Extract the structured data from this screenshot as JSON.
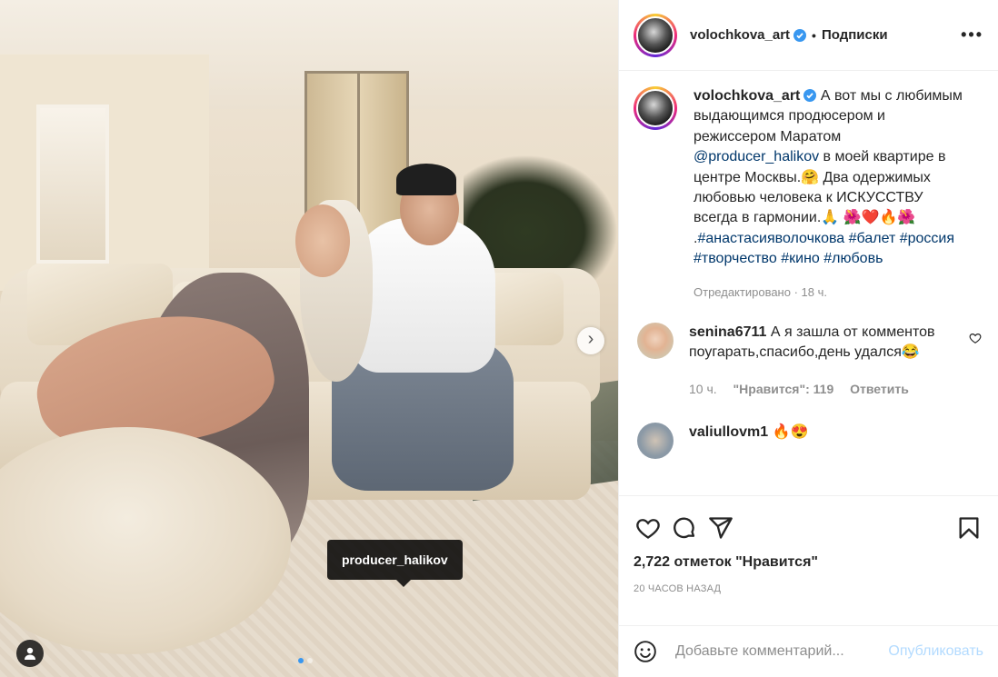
{
  "header": {
    "username": "volochkova_art",
    "separator": "•",
    "follow_label": "Подписки",
    "more_label": "•••"
  },
  "media": {
    "tag_label": "producer_halikov",
    "next_icon": "chevron-right-icon",
    "carousel_dots": 2,
    "active_dot": 1
  },
  "caption": {
    "username": "volochkova_art",
    "text_1": " А вот мы с любимым выдающимся продюсером и режиссером Маратом ",
    "mention": "@producer_halikov",
    "text_2": " в моей квартире в центре Москвы.🤗 Два одержимых любовью человека к ИСКУССТВУ всегда в гармонии.🙏 🌺❤️🔥🌺 .",
    "hashtag_1": "#анастасияволочкова",
    "hashtag_2": "#балет",
    "hashtag_3": "#россия",
    "hashtag_4": "#творчество",
    "hashtag_5": "#кино",
    "hashtag_6": "#любовь",
    "edited": "Отредактировано · 18 ч."
  },
  "comments": [
    {
      "username": "senina6711",
      "text": " А я зашла от комментов поугарать,спасибо,день удался😂",
      "time": "10 ч.",
      "likes": "\"Нравится\": 119",
      "reply": "Ответить"
    },
    {
      "username": "valiullovm1",
      "text": " 🔥😍"
    }
  ],
  "actions": {
    "likes": "2,722 отметок \"Нравится\"",
    "time_ago": "20 часов назад"
  },
  "add_comment": {
    "placeholder": "Добавьте комментарий...",
    "post_label": "Опубликовать"
  },
  "colors": {
    "link": "#00376b",
    "verified": "#3897f0",
    "muted": "#8e8e8e",
    "post_disabled": "#b3dbff"
  }
}
